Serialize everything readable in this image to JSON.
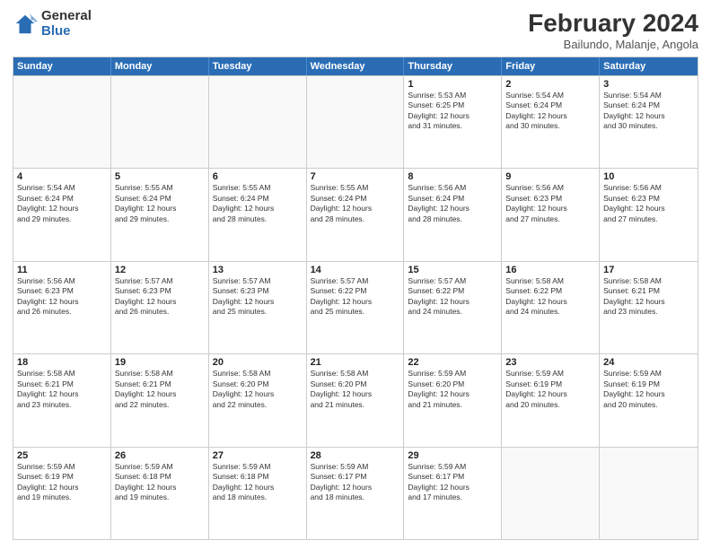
{
  "logo": {
    "general": "General",
    "blue": "Blue"
  },
  "header": {
    "title": "February 2024",
    "location": "Bailundo, Malanje, Angola"
  },
  "days_of_week": [
    "Sunday",
    "Monday",
    "Tuesday",
    "Wednesday",
    "Thursday",
    "Friday",
    "Saturday"
  ],
  "weeks": [
    [
      {
        "day": "",
        "info": ""
      },
      {
        "day": "",
        "info": ""
      },
      {
        "day": "",
        "info": ""
      },
      {
        "day": "",
        "info": ""
      },
      {
        "day": "1",
        "info": "Sunrise: 5:53 AM\nSunset: 6:25 PM\nDaylight: 12 hours\nand 31 minutes."
      },
      {
        "day": "2",
        "info": "Sunrise: 5:54 AM\nSunset: 6:24 PM\nDaylight: 12 hours\nand 30 minutes."
      },
      {
        "day": "3",
        "info": "Sunrise: 5:54 AM\nSunset: 6:24 PM\nDaylight: 12 hours\nand 30 minutes."
      }
    ],
    [
      {
        "day": "4",
        "info": "Sunrise: 5:54 AM\nSunset: 6:24 PM\nDaylight: 12 hours\nand 29 minutes."
      },
      {
        "day": "5",
        "info": "Sunrise: 5:55 AM\nSunset: 6:24 PM\nDaylight: 12 hours\nand 29 minutes."
      },
      {
        "day": "6",
        "info": "Sunrise: 5:55 AM\nSunset: 6:24 PM\nDaylight: 12 hours\nand 28 minutes."
      },
      {
        "day": "7",
        "info": "Sunrise: 5:55 AM\nSunset: 6:24 PM\nDaylight: 12 hours\nand 28 minutes."
      },
      {
        "day": "8",
        "info": "Sunrise: 5:56 AM\nSunset: 6:24 PM\nDaylight: 12 hours\nand 28 minutes."
      },
      {
        "day": "9",
        "info": "Sunrise: 5:56 AM\nSunset: 6:23 PM\nDaylight: 12 hours\nand 27 minutes."
      },
      {
        "day": "10",
        "info": "Sunrise: 5:56 AM\nSunset: 6:23 PM\nDaylight: 12 hours\nand 27 minutes."
      }
    ],
    [
      {
        "day": "11",
        "info": "Sunrise: 5:56 AM\nSunset: 6:23 PM\nDaylight: 12 hours\nand 26 minutes."
      },
      {
        "day": "12",
        "info": "Sunrise: 5:57 AM\nSunset: 6:23 PM\nDaylight: 12 hours\nand 26 minutes."
      },
      {
        "day": "13",
        "info": "Sunrise: 5:57 AM\nSunset: 6:23 PM\nDaylight: 12 hours\nand 25 minutes."
      },
      {
        "day": "14",
        "info": "Sunrise: 5:57 AM\nSunset: 6:22 PM\nDaylight: 12 hours\nand 25 minutes."
      },
      {
        "day": "15",
        "info": "Sunrise: 5:57 AM\nSunset: 6:22 PM\nDaylight: 12 hours\nand 24 minutes."
      },
      {
        "day": "16",
        "info": "Sunrise: 5:58 AM\nSunset: 6:22 PM\nDaylight: 12 hours\nand 24 minutes."
      },
      {
        "day": "17",
        "info": "Sunrise: 5:58 AM\nSunset: 6:21 PM\nDaylight: 12 hours\nand 23 minutes."
      }
    ],
    [
      {
        "day": "18",
        "info": "Sunrise: 5:58 AM\nSunset: 6:21 PM\nDaylight: 12 hours\nand 23 minutes."
      },
      {
        "day": "19",
        "info": "Sunrise: 5:58 AM\nSunset: 6:21 PM\nDaylight: 12 hours\nand 22 minutes."
      },
      {
        "day": "20",
        "info": "Sunrise: 5:58 AM\nSunset: 6:20 PM\nDaylight: 12 hours\nand 22 minutes."
      },
      {
        "day": "21",
        "info": "Sunrise: 5:58 AM\nSunset: 6:20 PM\nDaylight: 12 hours\nand 21 minutes."
      },
      {
        "day": "22",
        "info": "Sunrise: 5:59 AM\nSunset: 6:20 PM\nDaylight: 12 hours\nand 21 minutes."
      },
      {
        "day": "23",
        "info": "Sunrise: 5:59 AM\nSunset: 6:19 PM\nDaylight: 12 hours\nand 20 minutes."
      },
      {
        "day": "24",
        "info": "Sunrise: 5:59 AM\nSunset: 6:19 PM\nDaylight: 12 hours\nand 20 minutes."
      }
    ],
    [
      {
        "day": "25",
        "info": "Sunrise: 5:59 AM\nSunset: 6:19 PM\nDaylight: 12 hours\nand 19 minutes."
      },
      {
        "day": "26",
        "info": "Sunrise: 5:59 AM\nSunset: 6:18 PM\nDaylight: 12 hours\nand 19 minutes."
      },
      {
        "day": "27",
        "info": "Sunrise: 5:59 AM\nSunset: 6:18 PM\nDaylight: 12 hours\nand 18 minutes."
      },
      {
        "day": "28",
        "info": "Sunrise: 5:59 AM\nSunset: 6:17 PM\nDaylight: 12 hours\nand 18 minutes."
      },
      {
        "day": "29",
        "info": "Sunrise: 5:59 AM\nSunset: 6:17 PM\nDaylight: 12 hours\nand 17 minutes."
      },
      {
        "day": "",
        "info": ""
      },
      {
        "day": "",
        "info": ""
      }
    ]
  ]
}
